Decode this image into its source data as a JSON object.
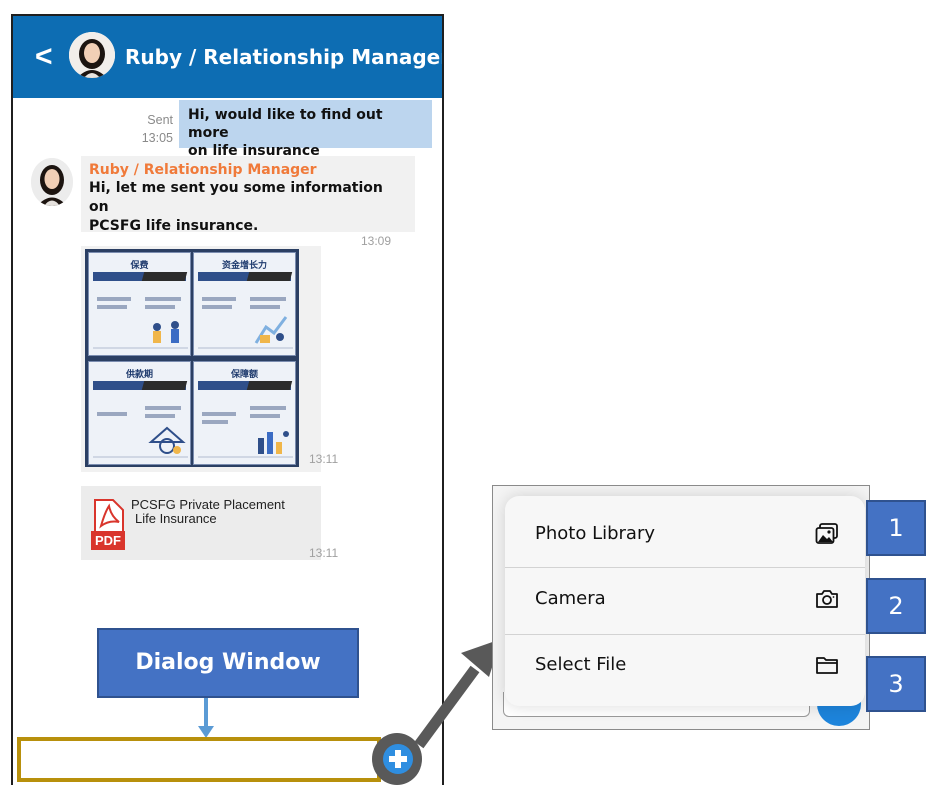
{
  "chat": {
    "header_title": "Ruby / Relationship Manager",
    "back_glyph": "<",
    "outgoing": {
      "status": "Sent",
      "time": "13:05",
      "line1": "Hi, would like to find out more",
      "line2": "on life insurance"
    },
    "incoming": {
      "sender": "Ruby / Relationship Manager",
      "line1": "Hi, let me sent you some information on",
      "line2": "PCSFG life insurance.",
      "time": "13:09"
    },
    "image_message": {
      "time": "13:11",
      "panels": [
        "保费",
        "资金增长力",
        "供款期",
        "保障额"
      ]
    },
    "file_message": {
      "icon": "pdf-icon",
      "icon_label": "PDF",
      "name_line1": "PCSFG Private Placement",
      "name_line2": "Life Insurance",
      "time": "13:11"
    }
  },
  "callout": {
    "dialog_label": "Dialog Window",
    "color": "#4472c4",
    "input_outline_color": "#b8900c"
  },
  "menu": {
    "items": [
      {
        "label": "Photo Library",
        "icon": "photo-library-icon",
        "badge": "1"
      },
      {
        "label": "Camera",
        "icon": "camera-icon",
        "badge": "2"
      },
      {
        "label": "Select File",
        "icon": "folder-icon",
        "badge": "3"
      }
    ]
  },
  "colors": {
    "header": "#0d6db3",
    "outgoing_bubble": "#bcd5ee",
    "sender_name": "#f07a3a",
    "plus_button": "#2f8ee0"
  }
}
